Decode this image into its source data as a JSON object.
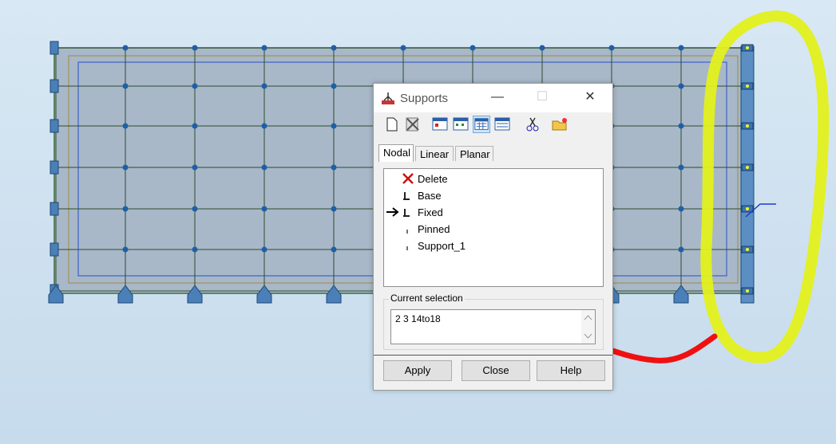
{
  "dialog": {
    "title": "Supports",
    "window_buttons": {
      "minimize": "—",
      "maximize": "☐",
      "close": "✕"
    },
    "toolbar": [
      "new-icon",
      "delete-icon",
      "view-icon",
      "view-icon",
      "table-icon",
      "table-icon",
      "cut-icon",
      "open-folder-icon"
    ],
    "tabs": [
      {
        "label": "Nodal",
        "selected": true
      },
      {
        "label": "Linear",
        "selected": false
      },
      {
        "label": "Planar",
        "selected": false
      }
    ],
    "list_items": [
      {
        "label": "Delete",
        "icon": "delete-x-icon"
      },
      {
        "label": "Base",
        "icon": "support-icon"
      },
      {
        "label": "Fixed",
        "icon": "support-icon",
        "current": true
      },
      {
        "label": "Pinned",
        "icon": "support-icon"
      },
      {
        "label": "Support_1",
        "icon": "support-icon"
      }
    ],
    "current_selection_label": "Current selection",
    "current_selection_value": "2 3 14to18",
    "buttons": {
      "apply": "Apply",
      "close": "Close",
      "help": "Help"
    }
  },
  "colors": {
    "highlight_yellow": "#e6f51a",
    "annotation_red": "#f01010",
    "mesh_fill": "#a8b8c9",
    "mesh_line": "#3d5a3a",
    "node_blue": "#1f5fa8"
  }
}
